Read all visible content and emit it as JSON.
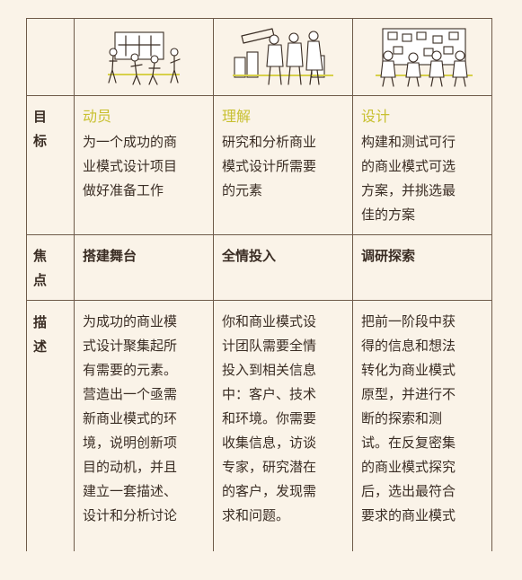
{
  "row_heads": {
    "goal": "目\n标",
    "focus": "焦\n点",
    "description": "描\n述"
  },
  "phases": [
    {
      "illustration": "people-preparing-board-illustration",
      "title": "动员",
      "goal": "为一个成功的商\n业模式设计项目\n做好准备工作",
      "focus": "搭建舞台",
      "description": "为成功的商业模\n式设计聚集起所\n有需要的元素。\n营造出一个亟需\n新商业模式的环\n境，说明创新项\n目的动机，并且\n建立一套描述、\n设计和分析讨论"
    },
    {
      "illustration": "people-with-telescope-illustration",
      "title": "理解",
      "goal": "研究和分析商业\n模式设计所需要\n的元素",
      "focus": "全情投入",
      "description": "你和商业模式设\n计团队需要全情\n投入到相关信息\n中：客户、技术\n和环境。你需要\n收集信息，访谈\n专家，研究潜在\n的客户，发现需\n求和问题。"
    },
    {
      "illustration": "people-at-wall-of-notes-illustration",
      "title": "设计",
      "goal": "构建和测试可行\n的商业模式可选\n方案，并挑选最\n佳的方案",
      "focus": "调研探索",
      "description": "把前一阶段中获\n得的信息和想法\n转化为商业模式\n原型，并进行不\n断的探索和测\n试。在反复密集\n的商业模式探究\n后，选出最符合\n要求的商业模式"
    }
  ],
  "colors": {
    "background": "#faf3e8",
    "title_accent": "#c8c030",
    "line": "#6e5a49",
    "text": "#3a2d24"
  }
}
